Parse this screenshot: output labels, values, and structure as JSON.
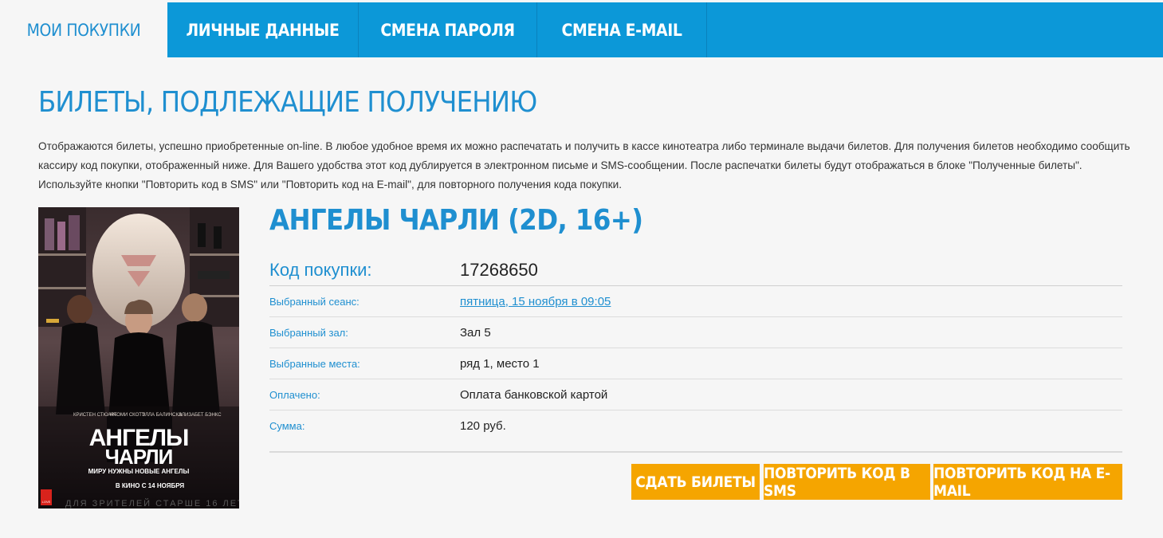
{
  "tabs": [
    {
      "label": "МОИ ПОКУПКИ",
      "active": true
    },
    {
      "label": "ЛИЧНЫЕ ДАННЫЕ"
    },
    {
      "label": "СМЕНА ПАРОЛЯ"
    },
    {
      "label": "СМЕНА E-MAIL"
    }
  ],
  "section": {
    "title": "БИЛЕТЫ, ПОДЛЕЖАЩИЕ ПОЛУЧЕНИЮ",
    "intro": "Отображаются билеты, успешно приобретенные on-line. В любое удобное время их можно распечатать и получить в кассе кинотеатра либо терминале выдачи билетов. Для получения билетов необходимо сообщить кассиру код покупки, отображенный ниже. Для Вашего удобства этот код дублируется в электронном письме и SMS-сообщении. После распечатки билеты будут отображаться в блоке \"Полученные билеты\". Используйте кнопки \"Повторить код в SMS\" или \"Повторить код на E-mail\", для повторного получения кода покупки."
  },
  "order": {
    "movie_title": "АНГЕЛЫ ЧАРЛИ (2D, 16+)",
    "code_label": "Код покупки:",
    "code_value": "17268650",
    "session_label": "Выбранный сеанс:",
    "session_value": "пятница, 15 ноября в 09:05",
    "hall_label": "Выбранный зал:",
    "hall_value": "Зал 5",
    "seats_label": "Выбранные места:",
    "seats_value": "ряд 1, место 1",
    "paid_label": "Оплачено:",
    "paid_value": "Оплата банковской картой",
    "sum_label": "Сумма:",
    "sum_value": "120 руб."
  },
  "poster": {
    "cast_1": "КРИСТЕН СТЮАРТ",
    "cast_2": "НАОМИ СКОТТ",
    "cast_3": "ЭЛЛА БАЛИНСКА",
    "cast_4": "ЭЛИЗАБЕТ БЭНКС",
    "title_line1": "АНГЕЛЫ",
    "title_line2": "ЧАРЛИ",
    "tagline": "МИРУ НУЖНЫ НОВЫЕ АНГЕЛЫ",
    "release": "В КИНО С 14 НОЯБРЯ",
    "age_note": "ДЛЯ ЗРИТЕЛЕЙ СТАРШЕ 16 ЛЕТ",
    "radio_badge": "LOVE"
  },
  "buttons": {
    "return": "СДАТЬ БИЛЕТЫ",
    "sms": "ПОВТОРИТЬ КОД В SMS",
    "email": "ПОВТОРИТЬ КОД НА E-MAIL"
  },
  "colors": {
    "brand_blue": "#0c98d8",
    "accent_orange": "#f5a500"
  }
}
